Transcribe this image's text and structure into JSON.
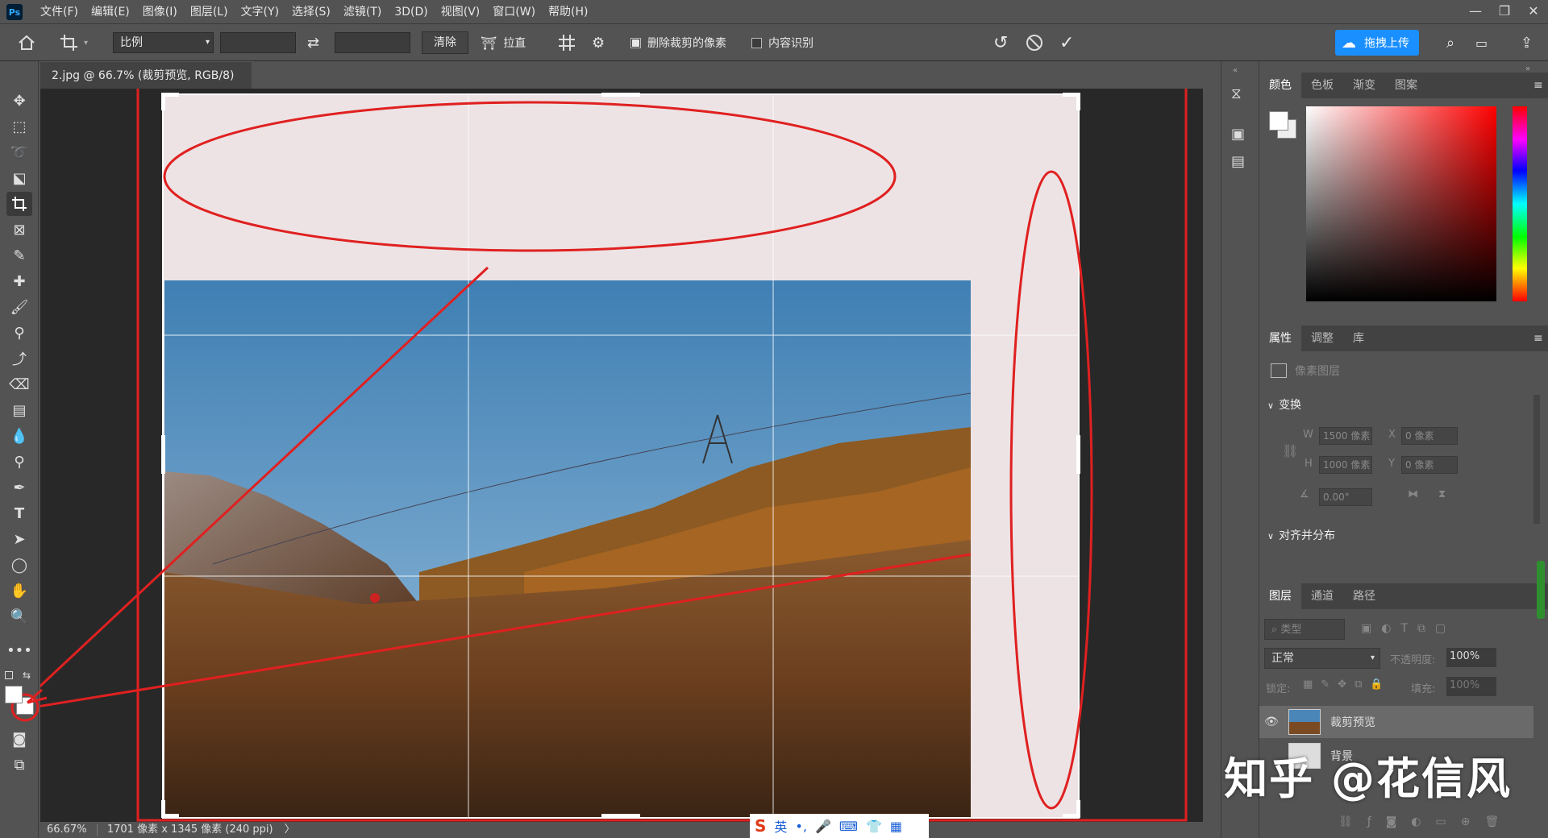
{
  "app": {
    "logo": "Ps"
  },
  "menu": [
    "文件(F)",
    "编辑(E)",
    "图像(I)",
    "图层(L)",
    "文字(Y)",
    "选择(S)",
    "滤镜(T)",
    "3D(D)",
    "视图(V)",
    "窗口(W)",
    "帮助(H)"
  ],
  "options": {
    "ratio_select": "比例",
    "clear_label": "清除",
    "straighten_label": "拉直",
    "delete_cropped_label": "删除裁剪的像素",
    "delete_cropped_checked": true,
    "content_aware_label": "内容识别",
    "content_aware_checked": false,
    "cloud_upload_label": "拖拽上传"
  },
  "document": {
    "tab_title": "2.jpg @ 66.7% (裁剪预览, RGB/8)",
    "status_zoom": "66.67%",
    "status_info": "1701 像素 x 1345 像素 (240 ppi)"
  },
  "color_panel": {
    "tabs": [
      "颜色",
      "色板",
      "渐变",
      "图案"
    ],
    "active": "颜色"
  },
  "properties_panel": {
    "tabs": [
      "属性",
      "调整",
      "库"
    ],
    "layer_type": "像素图层",
    "transform_header": "变换",
    "w_label": "W",
    "w_value": "1500 像素",
    "x_label": "X",
    "x_value": "0 像素",
    "h_label": "H",
    "h_value": "1000 像素",
    "y_label": "Y",
    "y_value": "0 像素",
    "angle_value": "0.00°",
    "align_header": "对齐并分布"
  },
  "layers_panel": {
    "tabs": [
      "图层",
      "通道",
      "路径"
    ],
    "filter_placeholder": "类型",
    "blend_mode": "正常",
    "opacity_label": "不透明度:",
    "opacity_value": "100%",
    "lock_label": "锁定:",
    "fill_label": "填充:",
    "fill_value": "100%",
    "layers": [
      {
        "name": "裁剪预览"
      },
      {
        "name": "背景"
      }
    ]
  },
  "watermark": "知乎 @花信风",
  "ime": {
    "mode": "英"
  }
}
